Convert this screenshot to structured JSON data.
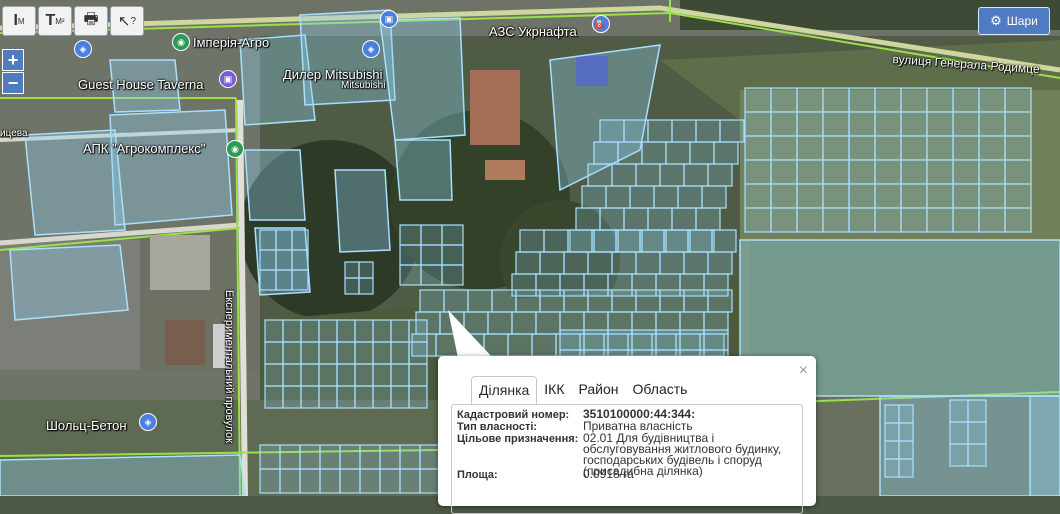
{
  "toolbar": {
    "buttons": [
      {
        "icon": "ruler-length-icon",
        "glyph": "I",
        "sub": "M"
      },
      {
        "icon": "ruler-area-icon",
        "glyph": "T",
        "sub": "M²"
      },
      {
        "icon": "print-icon",
        "glyph": "🖶",
        "sub": ""
      },
      {
        "icon": "pointer-help-icon",
        "glyph": "↖",
        "sub": "?"
      }
    ]
  },
  "zoom": {
    "in_label": "+",
    "out_label": "−"
  },
  "layers": {
    "label": "Шари",
    "icon": "gear-icon"
  },
  "map": {
    "labels": {
      "imperia": "Імперія-Агро",
      "azs": "АЗС Укрнафта",
      "guest_house": "Guest House Taverna",
      "dealer": "Дилер Mitsubishi",
      "mitsubishi": "Mitsubishi",
      "apk": "АПК \"Агрокомплекс\"",
      "street_left": "ицева",
      "street_gen": "вулиця Генерала Родимце",
      "lane": "Експериментальний провулок",
      "sholts": "Шольц-Бетон"
    },
    "colors": {
      "parcel_fill": "#8fd0f0",
      "parcel_stroke": "#a8e0ff",
      "road": "#cfd6a0",
      "boundary": "#9be04a"
    }
  },
  "popup": {
    "close_label": "×",
    "tabs": [
      "Ділянка",
      "ІКК",
      "Район",
      "Область"
    ],
    "active_tab": 0,
    "fields": [
      {
        "label": "Кадастровий номер:",
        "value": "3510100000:44:344:"
      },
      {
        "label": "Тип власності:",
        "value": "Приватна власність"
      },
      {
        "label": "Цільове призначення:",
        "value": "02.01 Для будівництва і обслуговування житлового будинку, господарських будівель і споруд (присадибна ділянка)"
      },
      {
        "label": "Площа:",
        "value": "0.0918 га"
      }
    ]
  }
}
